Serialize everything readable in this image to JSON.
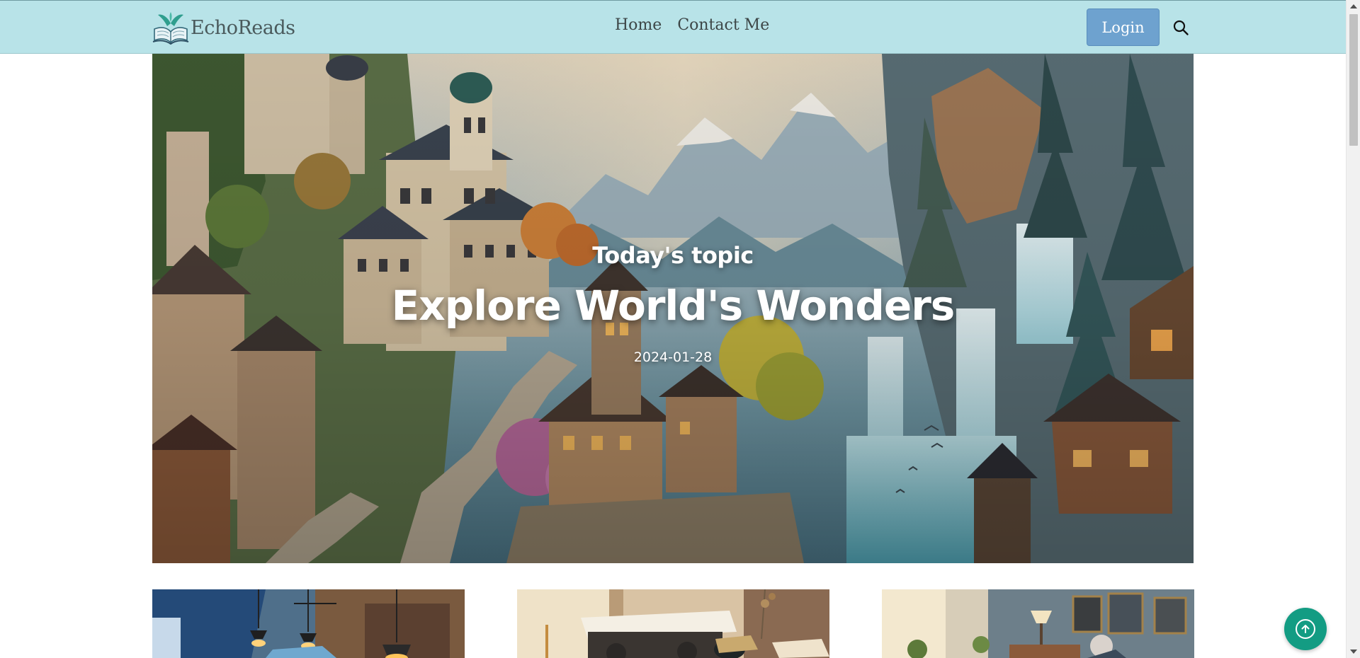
{
  "brand": {
    "name": "EchoReads",
    "logo_icon": "open-book-icon"
  },
  "nav": {
    "links": [
      {
        "label": "Home"
      },
      {
        "label": "Contact Me"
      }
    ]
  },
  "header": {
    "login_label": "Login",
    "search_icon": "search-icon"
  },
  "hero": {
    "eyebrow": "Today's topic",
    "title": "Explore World's Wonders",
    "date": "2024-01-28"
  },
  "cards": [
    {
      "image": "workshop-lamps-image"
    },
    {
      "image": "typewriter-desk-image"
    },
    {
      "image": "writer-room-image"
    }
  ],
  "back_to_top": {
    "icon": "arrow-up-icon"
  },
  "colors": {
    "navbar": "#b8e3e8",
    "login": "#6ea2cf",
    "back_to_top": "#139c83"
  }
}
